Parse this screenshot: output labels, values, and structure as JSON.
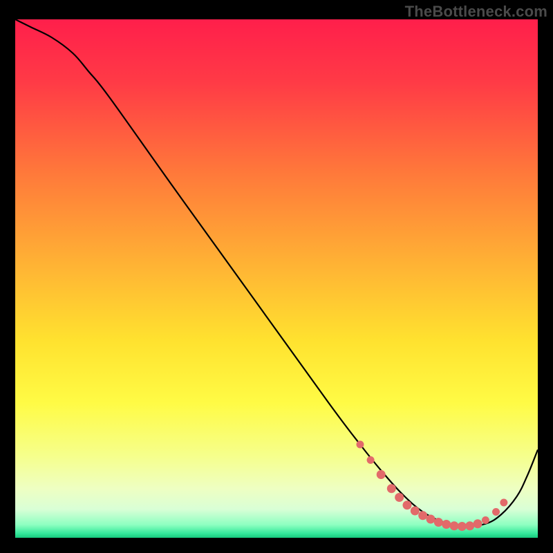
{
  "watermark": "TheBottleneck.com",
  "chart_data": {
    "type": "line",
    "title": "",
    "xlabel": "",
    "ylabel": "",
    "xlim": [
      0,
      100
    ],
    "ylim": [
      0,
      100
    ],
    "gradient_stops": [
      {
        "offset": 0.0,
        "color": "#ff1f4b"
      },
      {
        "offset": 0.12,
        "color": "#ff3a46"
      },
      {
        "offset": 0.3,
        "color": "#ff7a3a"
      },
      {
        "offset": 0.48,
        "color": "#ffb534"
      },
      {
        "offset": 0.62,
        "color": "#ffe22f"
      },
      {
        "offset": 0.74,
        "color": "#fffb45"
      },
      {
        "offset": 0.84,
        "color": "#f6ff8a"
      },
      {
        "offset": 0.905,
        "color": "#eeffc2"
      },
      {
        "offset": 0.945,
        "color": "#d9ffd6"
      },
      {
        "offset": 0.975,
        "color": "#8dffc1"
      },
      {
        "offset": 0.992,
        "color": "#32e89a"
      },
      {
        "offset": 1.0,
        "color": "#18c87e"
      }
    ],
    "series": [
      {
        "name": "bottleneck-curve",
        "x": [
          0,
          3,
          7,
          11,
          14,
          18,
          30,
          45,
          60,
          66,
          70,
          74,
          78,
          82,
          86,
          90,
          93,
          96,
          98,
          100
        ],
        "y": [
          100,
          98.5,
          96.5,
          93.5,
          90,
          85,
          68,
          47,
          26,
          18,
          13,
          8.5,
          5,
          3,
          2.2,
          2.7,
          4.5,
          8,
          12,
          17
        ]
      }
    ],
    "markers": {
      "name": "highlight-band",
      "color": "#e26a6a",
      "points": [
        {
          "x": 66,
          "y": 18,
          "r": 5
        },
        {
          "x": 68,
          "y": 15,
          "r": 5
        },
        {
          "x": 70,
          "y": 12.2,
          "r": 6
        },
        {
          "x": 72,
          "y": 9.5,
          "r": 6
        },
        {
          "x": 73.5,
          "y": 7.8,
          "r": 6
        },
        {
          "x": 75,
          "y": 6.3,
          "r": 6
        },
        {
          "x": 76.5,
          "y": 5.2,
          "r": 6
        },
        {
          "x": 78,
          "y": 4.3,
          "r": 6
        },
        {
          "x": 79.5,
          "y": 3.6,
          "r": 6
        },
        {
          "x": 81,
          "y": 3.0,
          "r": 6
        },
        {
          "x": 82.5,
          "y": 2.6,
          "r": 6
        },
        {
          "x": 84,
          "y": 2.3,
          "r": 6
        },
        {
          "x": 85.5,
          "y": 2.2,
          "r": 6
        },
        {
          "x": 87,
          "y": 2.3,
          "r": 6
        },
        {
          "x": 88.5,
          "y": 2.7,
          "r": 6
        },
        {
          "x": 90,
          "y": 3.4,
          "r": 5
        },
        {
          "x": 92,
          "y": 5.0,
          "r": 5
        },
        {
          "x": 93.5,
          "y": 6.8,
          "r": 5
        }
      ]
    }
  }
}
